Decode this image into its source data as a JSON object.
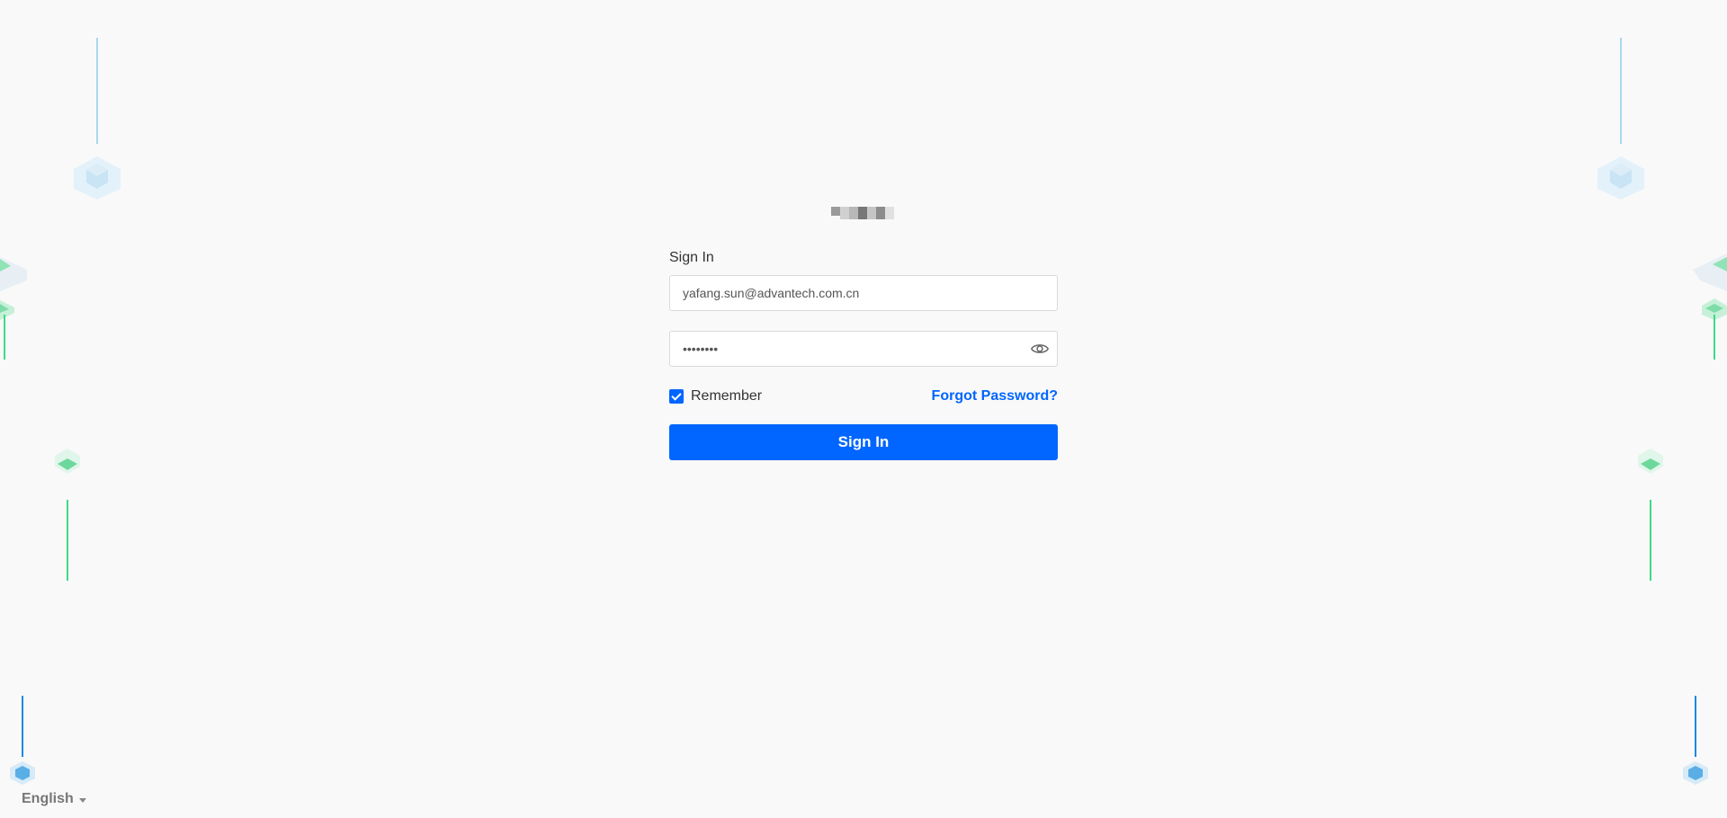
{
  "signin": {
    "title": "Sign In",
    "email_value": "yafang.sun@advantech.com.cn",
    "password_value": "••••••••",
    "remember_label": "Remember",
    "remember_checked": true,
    "forgot_label": "Forgot Password?",
    "button_label": "Sign In"
  },
  "language": {
    "selected": "English"
  },
  "colors": {
    "primary": "#0066ff",
    "background": "#f9f9f9",
    "line_blue_light": "#a9d8ee",
    "line_green": "#3ddc84",
    "line_blue": "#1e88e5"
  },
  "icons": {
    "password_toggle": "eye-icon",
    "language_dropdown": "caret-down-icon"
  }
}
